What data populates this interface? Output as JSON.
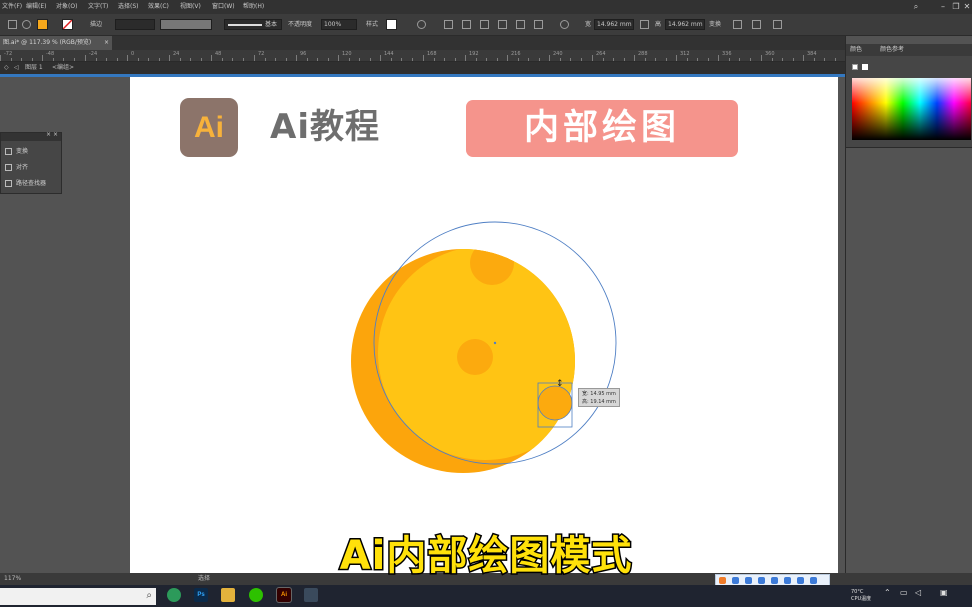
{
  "menubar": {
    "items": [
      "文件(F)",
      "编辑(E)",
      "对象(O)",
      "文字(T)",
      "选择(S)",
      "效果(C)",
      "视图(V)",
      "窗口(W)",
      "帮助(H)"
    ],
    "icons": [
      "search-icon",
      "minimize-icon",
      "restore-icon",
      "close-icon"
    ]
  },
  "controlbar": {
    "fill_color": "#f7a81b",
    "stroke_label": "描边",
    "stroke_weight_label": "基本",
    "opacity_label": "不透明度",
    "opacity_value": "100%",
    "style_label": "样式",
    "x_label": "宽",
    "x_value": "14.962 mm",
    "y_label": "高",
    "y_value": "14.962 mm",
    "transform_label": "变换"
  },
  "document_tab": {
    "title": "图.ai* @ 117.39 % (RGB/预览)"
  },
  "breadcrumb": {
    "layer": "图层 1",
    "group": "<编组>"
  },
  "ruler": {
    "labels": [
      "-72",
      "-48",
      "-24",
      "0",
      "24",
      "48",
      "72",
      "96",
      "120",
      "144",
      "168",
      "192",
      "216",
      "240",
      "264",
      "288",
      "312",
      "336",
      "360",
      "384"
    ]
  },
  "artboard": {
    "logo_text": "Ai",
    "title": "Ai教程",
    "badge": "内部绘图"
  },
  "left_panel": {
    "items": [
      "变换",
      "对齐",
      "路径查找器"
    ]
  },
  "right_panel": {
    "tabs": [
      "颜色",
      "颜色参考"
    ]
  },
  "measure_tooltip": {
    "line1": "宽: 14.95 mm",
    "line2": "高: 19.14 mm"
  },
  "statusbar": {
    "zoom": "117%",
    "tool": "选择"
  },
  "taskbar": {
    "apps": [
      "edge",
      "photoshop",
      "file-explorer",
      "wechat",
      "illustrator",
      "camera"
    ],
    "weather": "70°C",
    "cpu": "CPU温度"
  },
  "subtitle": "Ai内部绘图模式",
  "colors": {
    "moon_main": "#ffc414",
    "moon_shadow": "#fca50c",
    "crater": "#fcaa0e",
    "selection_blue": "#4f7fc4"
  }
}
